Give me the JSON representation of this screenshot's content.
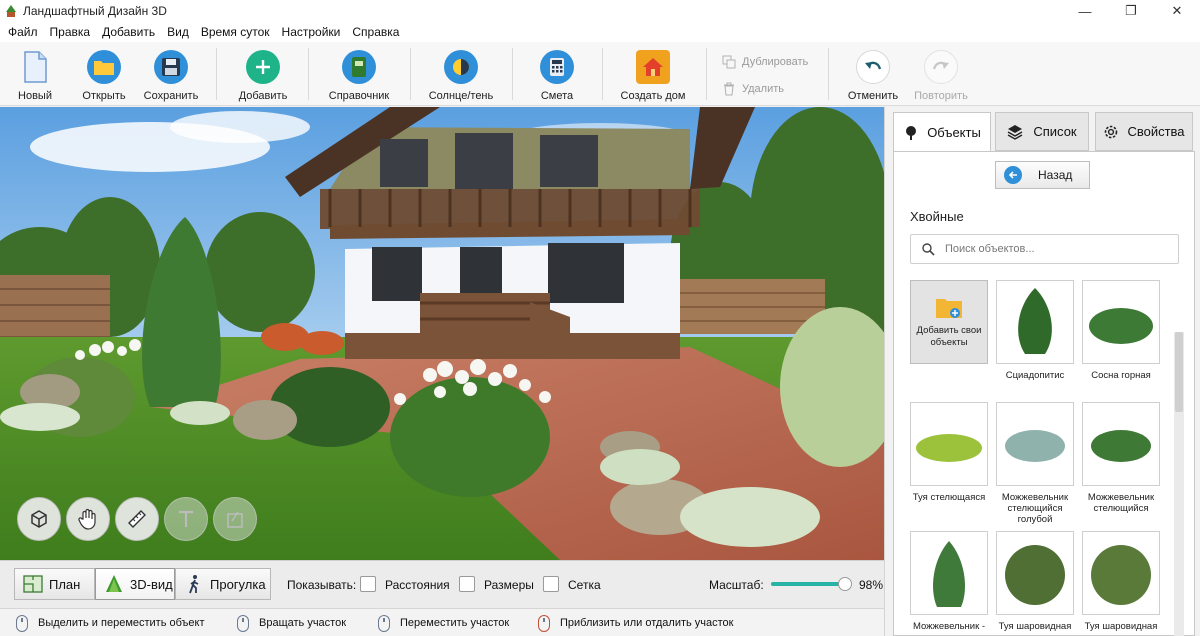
{
  "window": {
    "title": "Ландшафтный Дизайн 3D",
    "controls": {
      "minimize": "—",
      "maximize": "❐",
      "close": "✕"
    }
  },
  "menu": [
    "Файл",
    "Правка",
    "Добавить",
    "Вид",
    "Время суток",
    "Настройки",
    "Справка"
  ],
  "toolbar": {
    "new": "Новый",
    "open": "Открыть",
    "save": "Сохранить",
    "add": "Добавить",
    "reference": "Справочник",
    "sun_shadow": "Солнце/тень",
    "estimate": "Смета",
    "create_house": "Создать дом",
    "duplicate": "Дублировать",
    "delete": "Удалить",
    "undo": "Отменить",
    "redo": "Повторить"
  },
  "view_modes": {
    "plan": "План",
    "view3d": "3D-вид",
    "walk": "Прогулка",
    "active": "3D-вид"
  },
  "show": {
    "label": "Показывать:",
    "distances": "Расстояния",
    "sizes": "Размеры",
    "grid": "Сетка",
    "checked": {
      "distances": false,
      "sizes": false,
      "grid": false
    }
  },
  "scale": {
    "label": "Масштаб:",
    "value_text": "98%",
    "value": 0.98
  },
  "status": {
    "select_move": "Выделить и переместить объект",
    "rotate": "Вращать участок",
    "move": "Переместить участок",
    "zoom": "Приблизить или отдалить участок"
  },
  "panel": {
    "tabs": {
      "objects": "Объекты",
      "list": "Список",
      "properties": "Свойства",
      "active": "Объекты"
    },
    "back": "Назад",
    "category": "Хвойные",
    "search_placeholder": "Поиск объектов...",
    "add_own": "Добавить свои объекты",
    "items": [
      {
        "name": "Сциадопитис",
        "color": "#2f6a2a"
      },
      {
        "name": "Сосна горная",
        "color": "#3d7a35"
      },
      {
        "name": "Туя стелющаяся",
        "color": "#9bc23a"
      },
      {
        "name": "Можжевельник стелющийся голубой",
        "color": "#8fb2ad"
      },
      {
        "name": "Можжевельник стелющийся",
        "color": "#3e7a36"
      },
      {
        "name": "Можжевельник -",
        "color": "#3f7a3a"
      },
      {
        "name": "Туя шаровидная -",
        "color": "#4f6f34"
      },
      {
        "name": "Туя шаровидная -",
        "color": "#5a7a3a"
      }
    ]
  }
}
